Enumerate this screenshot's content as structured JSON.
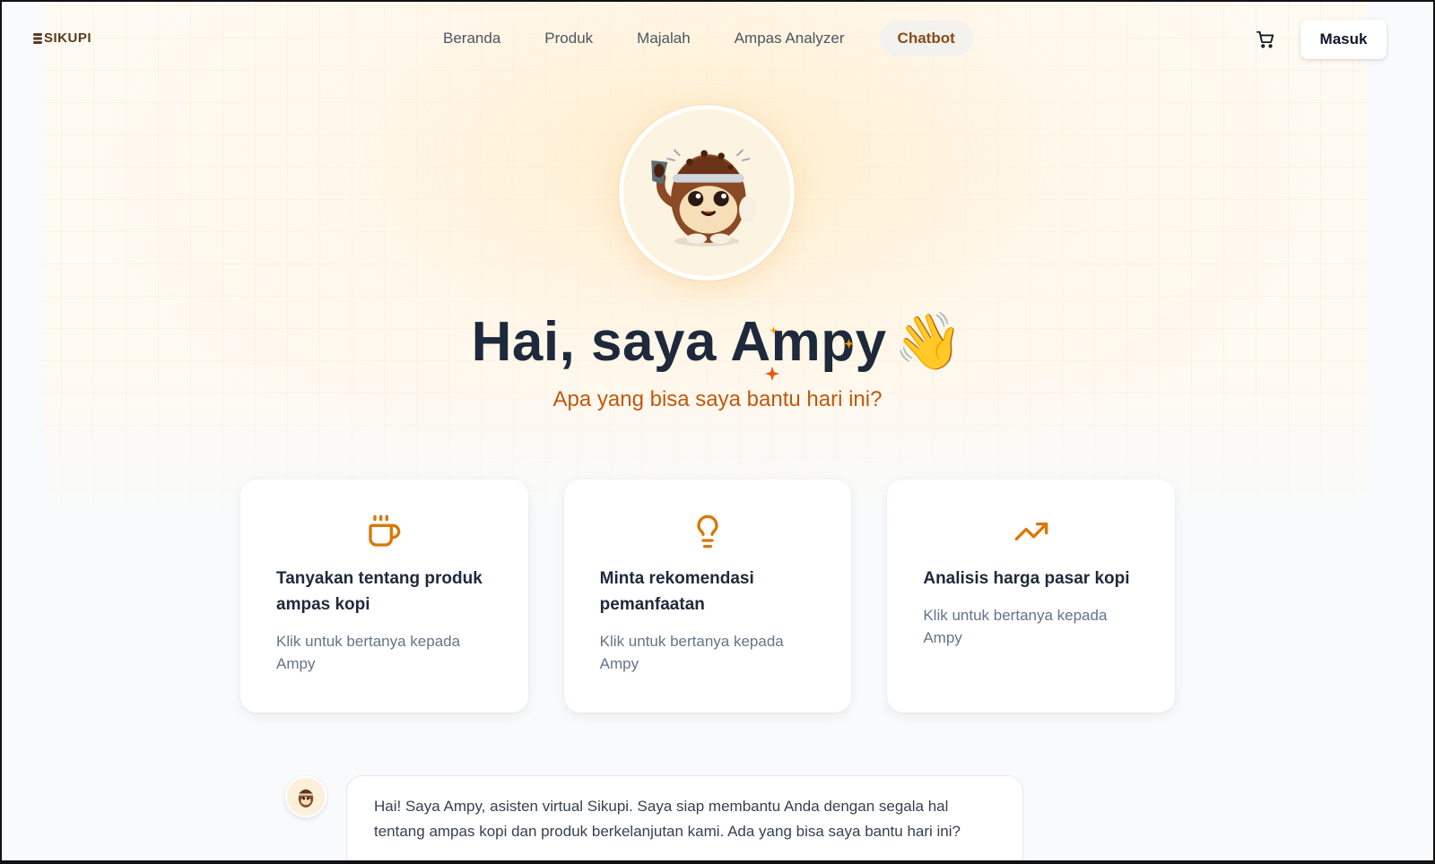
{
  "brand": {
    "name": "SIKUPI"
  },
  "nav": {
    "items": [
      {
        "label": "Beranda",
        "active": false
      },
      {
        "label": "Produk",
        "active": false
      },
      {
        "label": "Majalah",
        "active": false
      },
      {
        "label": "Ampas Analyzer",
        "active": false
      },
      {
        "label": "Chatbot",
        "active": true
      }
    ],
    "cart_icon": "shopping-cart-icon",
    "login_label": "Masuk"
  },
  "hero": {
    "avatar_icon": "ampy-mascot",
    "title": "Hai, saya Ampy",
    "title_emoji": "👋",
    "subtitle": "Apa yang bisa saya bantu hari ini?"
  },
  "cards": [
    {
      "icon": "coffee-cup-icon",
      "title": "Tanyakan tentang produk ampas kopi",
      "subtitle": "Klik untuk bertanya kepada Ampy"
    },
    {
      "icon": "lightbulb-icon",
      "title": "Minta rekomendasi pemanfaatan",
      "subtitle": "Klik untuk bertanya kepada Ampy"
    },
    {
      "icon": "trending-up-icon",
      "title": "Analisis harga pasar kopi",
      "subtitle": "Klik untuk bertanya kepada Ampy"
    }
  ],
  "chat": {
    "messages": [
      {
        "sender": "Ampy",
        "text": "Hai! Saya Ampy, asisten virtual Sikupi. Saya siap membantu Anda dengan segala hal tentang ampas kopi dan produk berkelanjutan kami. Ada yang bisa saya bantu hari ini?"
      }
    ]
  },
  "colors": {
    "accent": "#c2570c",
    "icon": "#d97706",
    "brand_brown": "#8a4b18",
    "title": "#1e293b"
  }
}
